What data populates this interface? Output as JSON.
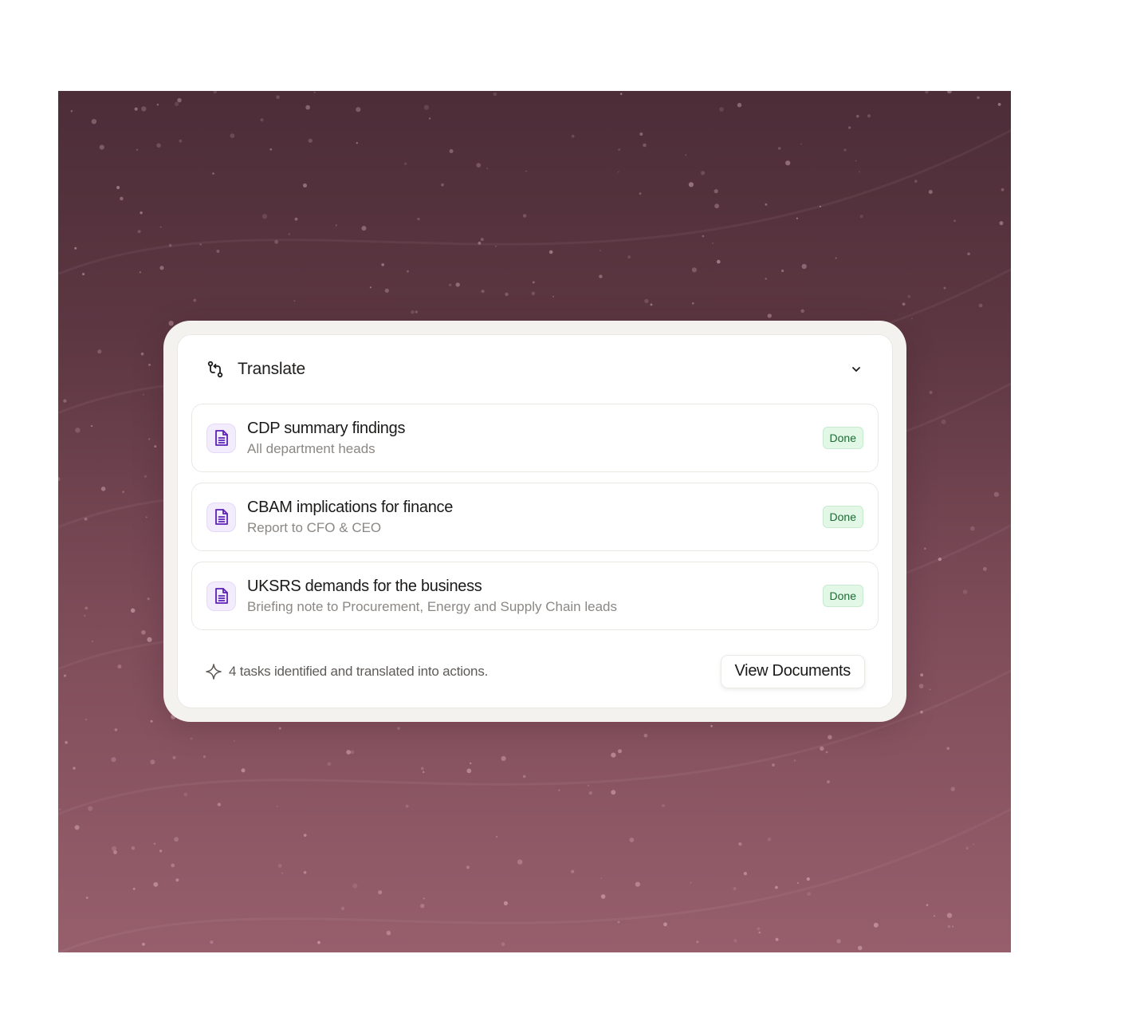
{
  "panel": {
    "title": "Translate",
    "header_icon": "route-icon",
    "collapse_icon": "chevron-down-icon"
  },
  "tasks": [
    {
      "title": "CDP summary findings",
      "subtitle": "All department heads",
      "status": "Done",
      "icon": "document-icon"
    },
    {
      "title": "CBAM implications for finance",
      "subtitle": "Report to CFO & CEO",
      "status": "Done",
      "icon": "document-icon"
    },
    {
      "title": "UKSRS demands for the business",
      "subtitle": "Briefing note to Procurement, Energy and Supply Chain leads",
      "status": "Done",
      "icon": "document-icon"
    }
  ],
  "footer": {
    "summary": "4 tasks identified and translated into actions.",
    "summary_icon": "sparkle-icon",
    "button_label": "View Documents"
  },
  "colors": {
    "background_top": "#4c2d38",
    "background_bottom": "#975f6c",
    "accent_icon": "#5b21b6",
    "status_bg": "#e2f7e6",
    "status_text": "#1d6b35"
  }
}
